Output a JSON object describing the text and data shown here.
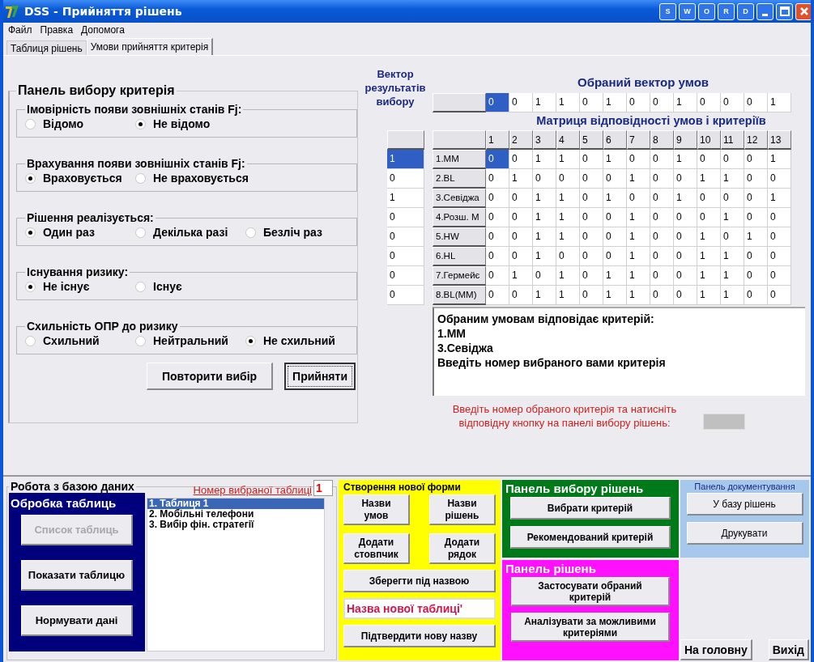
{
  "window": {
    "title": "DSS - Прийняття рішень",
    "title_buttons": [
      "S",
      "W",
      "O",
      "R",
      "D"
    ]
  },
  "menu": [
    "Файл",
    "Правка",
    "Допомога"
  ],
  "tabs": [
    {
      "label": "Таблиця рішень",
      "selected": false
    },
    {
      "label": "Умови прийняття критерія",
      "selected": true
    }
  ],
  "criteria_panel": {
    "title": "Панель вибору критерія",
    "groups": [
      {
        "title": "Імовірність появи зовнішніх станів Fj:",
        "options": [
          {
            "label": "Відомо",
            "selected": false
          },
          {
            "label": "Не відомо",
            "selected": true
          }
        ]
      },
      {
        "title": "Врахування появи зовнішніх станів Fj:",
        "options": [
          {
            "label": "Враховується",
            "selected": true
          },
          {
            "label": "Не враховується",
            "selected": false
          }
        ]
      },
      {
        "title": "Рішення реалізується:",
        "options": [
          {
            "label": "Один раз",
            "selected": true
          },
          {
            "label": "Декілька разі",
            "selected": false
          },
          {
            "label": "Безліч раз",
            "selected": false
          }
        ]
      },
      {
        "title": "Існування ризику:",
        "options": [
          {
            "label": "Не існує",
            "selected": true
          },
          {
            "label": "Існує",
            "selected": false
          }
        ]
      },
      {
        "title": "Схильність ОПР до ризику",
        "options": [
          {
            "label": "Схильний",
            "selected": false
          },
          {
            "label": "Нейтральний",
            "selected": false
          },
          {
            "label": "Не схильний",
            "selected": true
          }
        ]
      }
    ],
    "buttons": [
      {
        "label": "Повторити вибір",
        "focused": false
      },
      {
        "label": "Прийняти",
        "focused": true
      }
    ]
  },
  "result_vector": {
    "title": "Вектор результатів вибору",
    "values": [
      {
        "value": "1",
        "selected": true
      },
      {
        "value": "0",
        "selected": false
      },
      {
        "value": "1",
        "selected": false
      },
      {
        "value": "0",
        "selected": false
      },
      {
        "value": "0",
        "selected": false
      },
      {
        "value": "0",
        "selected": false
      },
      {
        "value": "0",
        "selected": false
      },
      {
        "value": "0",
        "selected": false
      }
    ]
  },
  "conditions_vector": {
    "title": "Обраний вектор умов",
    "values": [
      {
        "value": "0",
        "selected": true
      },
      {
        "value": "0",
        "selected": false
      },
      {
        "value": "1",
        "selected": false
      },
      {
        "value": "1",
        "selected": false
      },
      {
        "value": "0",
        "selected": false
      },
      {
        "value": "1",
        "selected": false
      },
      {
        "value": "0",
        "selected": false
      },
      {
        "value": "0",
        "selected": false
      },
      {
        "value": "1",
        "selected": false
      },
      {
        "value": "0",
        "selected": false
      },
      {
        "value": "0",
        "selected": false
      },
      {
        "value": "0",
        "selected": false
      },
      {
        "value": "1",
        "selected": false
      }
    ]
  },
  "matrix": {
    "title": "Матриця відповідності умов і критеріїв",
    "columns": [
      "1",
      "2",
      "3",
      "4",
      "5",
      "6",
      "7",
      "8",
      "9",
      "10",
      "11",
      "12",
      "13"
    ],
    "rows": [
      {
        "name": "1.MM",
        "cells": [
          {
            "value": "0",
            "selected": true
          },
          {
            "value": "0",
            "selected": false
          },
          {
            "value": "1",
            "selected": false
          },
          {
            "value": "1",
            "selected": false
          },
          {
            "value": "0",
            "selected": false
          },
          {
            "value": "1",
            "selected": false
          },
          {
            "value": "0",
            "selected": false
          },
          {
            "value": "0",
            "selected": false
          },
          {
            "value": "1",
            "selected": false
          },
          {
            "value": "0",
            "selected": false
          },
          {
            "value": "0",
            "selected": false
          },
          {
            "value": "0",
            "selected": false
          },
          {
            "value": "1",
            "selected": false
          }
        ]
      },
      {
        "name": "2.BL",
        "cells": [
          {
            "value": "0",
            "selected": false
          },
          {
            "value": "1",
            "selected": false
          },
          {
            "value": "0",
            "selected": false
          },
          {
            "value": "0",
            "selected": false
          },
          {
            "value": "0",
            "selected": false
          },
          {
            "value": "0",
            "selected": false
          },
          {
            "value": "1",
            "selected": false
          },
          {
            "value": "0",
            "selected": false
          },
          {
            "value": "0",
            "selected": false
          },
          {
            "value": "1",
            "selected": false
          },
          {
            "value": "1",
            "selected": false
          },
          {
            "value": "0",
            "selected": false
          },
          {
            "value": "0",
            "selected": false
          }
        ]
      },
      {
        "name": "3.Севіджа",
        "cells": [
          {
            "value": "0",
            "selected": false
          },
          {
            "value": "0",
            "selected": false
          },
          {
            "value": "1",
            "selected": false
          },
          {
            "value": "1",
            "selected": false
          },
          {
            "value": "0",
            "selected": false
          },
          {
            "value": "1",
            "selected": false
          },
          {
            "value": "0",
            "selected": false
          },
          {
            "value": "0",
            "selected": false
          },
          {
            "value": "1",
            "selected": false
          },
          {
            "value": "0",
            "selected": false
          },
          {
            "value": "0",
            "selected": false
          },
          {
            "value": "0",
            "selected": false
          },
          {
            "value": "1",
            "selected": false
          }
        ]
      },
      {
        "name": "4.Розш. М",
        "cells": [
          {
            "value": "0",
            "selected": false
          },
          {
            "value": "0",
            "selected": false
          },
          {
            "value": "1",
            "selected": false
          },
          {
            "value": "1",
            "selected": false
          },
          {
            "value": "0",
            "selected": false
          },
          {
            "value": "0",
            "selected": false
          },
          {
            "value": "1",
            "selected": false
          },
          {
            "value": "0",
            "selected": false
          },
          {
            "value": "0",
            "selected": false
          },
          {
            "value": "0",
            "selected": false
          },
          {
            "value": "1",
            "selected": false
          },
          {
            "value": "0",
            "selected": false
          },
          {
            "value": "0",
            "selected": false
          }
        ]
      },
      {
        "name": "5.HW",
        "cells": [
          {
            "value": "0",
            "selected": false
          },
          {
            "value": "0",
            "selected": false
          },
          {
            "value": "1",
            "selected": false
          },
          {
            "value": "1",
            "selected": false
          },
          {
            "value": "0",
            "selected": false
          },
          {
            "value": "0",
            "selected": false
          },
          {
            "value": "1",
            "selected": false
          },
          {
            "value": "0",
            "selected": false
          },
          {
            "value": "0",
            "selected": false
          },
          {
            "value": "1",
            "selected": false
          },
          {
            "value": "0",
            "selected": false
          },
          {
            "value": "1",
            "selected": false
          },
          {
            "value": "0",
            "selected": false
          }
        ]
      },
      {
        "name": "6.HL",
        "cells": [
          {
            "value": "0",
            "selected": false
          },
          {
            "value": "0",
            "selected": false
          },
          {
            "value": "1",
            "selected": false
          },
          {
            "value": "0",
            "selected": false
          },
          {
            "value": "0",
            "selected": false
          },
          {
            "value": "0",
            "selected": false
          },
          {
            "value": "1",
            "selected": false
          },
          {
            "value": "0",
            "selected": false
          },
          {
            "value": "0",
            "selected": false
          },
          {
            "value": "1",
            "selected": false
          },
          {
            "value": "1",
            "selected": false
          },
          {
            "value": "0",
            "selected": false
          },
          {
            "value": "0",
            "selected": false
          }
        ]
      },
      {
        "name": "7.Гермейє",
        "cells": [
          {
            "value": "0",
            "selected": false
          },
          {
            "value": "1",
            "selected": false
          },
          {
            "value": "0",
            "selected": false
          },
          {
            "value": "1",
            "selected": false
          },
          {
            "value": "0",
            "selected": false
          },
          {
            "value": "1",
            "selected": false
          },
          {
            "value": "1",
            "selected": false
          },
          {
            "value": "0",
            "selected": false
          },
          {
            "value": "0",
            "selected": false
          },
          {
            "value": "1",
            "selected": false
          },
          {
            "value": "1",
            "selected": false
          },
          {
            "value": "0",
            "selected": false
          },
          {
            "value": "0",
            "selected": false
          }
        ]
      },
      {
        "name": "8.BL(MM)",
        "cells": [
          {
            "value": "0",
            "selected": false
          },
          {
            "value": "0",
            "selected": false
          },
          {
            "value": "1",
            "selected": false
          },
          {
            "value": "1",
            "selected": false
          },
          {
            "value": "0",
            "selected": false
          },
          {
            "value": "1",
            "selected": false
          },
          {
            "value": "1",
            "selected": false
          },
          {
            "value": "0",
            "selected": false
          },
          {
            "value": "0",
            "selected": false
          },
          {
            "value": "1",
            "selected": false
          },
          {
            "value": "1",
            "selected": false
          },
          {
            "value": "0",
            "selected": false
          },
          {
            "value": "0",
            "selected": false
          }
        ]
      }
    ]
  },
  "message": [
    "Обраним умовам відповідає критерій:",
    "1.MM",
    "3.Севіджа",
    "Введіть номер вибраного вами критерія"
  ],
  "hint": "Введіть номер обраного критерія та натисніть відповідну кнопку на панелі вибору рішень:",
  "database": {
    "title": "Робота з базою даних",
    "table_number_label": "Номер вибраної таблиці",
    "table_number": "1",
    "processing": {
      "title": "Обробка таблиць",
      "buttons": [
        {
          "label": "Список таблиць",
          "disabled": true
        },
        {
          "label": "Показати таблицю",
          "disabled": false
        },
        {
          "label": "Нормувати дані",
          "disabled": false
        }
      ]
    },
    "tables": [
      {
        "label": "1.  Таблиця 1",
        "selected": true
      },
      {
        "label": "2.  Мобільні телефони",
        "selected": false
      },
      {
        "label": "3.  Вибір фін. стратегії",
        "selected": false
      }
    ]
  },
  "new_form": {
    "title": "Створення нової форми",
    "grid_buttons": [
      "Назви умов",
      "Назви рішень",
      "Додати стовпчик",
      "Додати рядок"
    ],
    "save_button": "Зберегти під назвою",
    "name_value": "Назва нової таблиці'",
    "confirm_button": "Підтвердити нову назву"
  },
  "choice_panel": {
    "title": "Панель вибору рішень",
    "buttons": [
      "Вибрати критерій",
      "Рекомендований критерій"
    ]
  },
  "solutions_panel": {
    "title": "Панель рішень",
    "buttons": [
      "Застосувати обраний критерій",
      "Аналізувати  за можливими критеріями"
    ]
  },
  "docs_panel": {
    "title": "Панель документування",
    "buttons": [
      "У базу рішень",
      "Друкувати"
    ]
  },
  "nav_buttons": [
    "На головну",
    "Вихід"
  ]
}
